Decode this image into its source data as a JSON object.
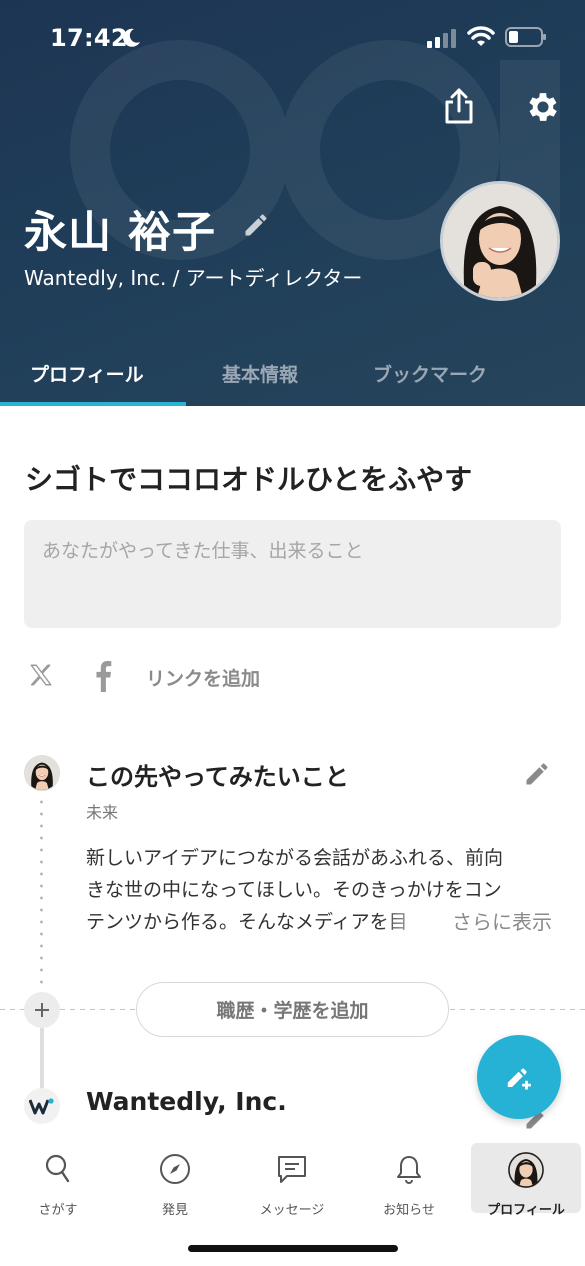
{
  "status_bar": {
    "time": "17:42"
  },
  "profile": {
    "name": "永山 裕子",
    "subtitle": "Wantedly, Inc. / アートディレクター"
  },
  "tabs": [
    {
      "label": "プロフィール",
      "active": true
    },
    {
      "label": "基本情報",
      "active": false
    },
    {
      "label": "ブックマーク",
      "active": false
    }
  ],
  "main": {
    "tagline": "シゴトでココロオドルひとをふやす",
    "about_placeholder": "あなたがやってきた仕事、出来ること",
    "add_link_label": "リンクを追加"
  },
  "future": {
    "title": "この先やってみたいこと",
    "label": "未来",
    "lines": [
      "新しいアイデアにつながる会話があふれる、前向",
      "きな世の中になってほしい。そのきっかけをコン",
      "テンツから作る。そんなメディアを目"
    ],
    "see_more": "さらに表示"
  },
  "career": {
    "add_button_label": "職歴・学歴を追加",
    "company_name": "Wantedly, Inc."
  },
  "bottom_nav": {
    "items": [
      {
        "label": "さがす",
        "icon": "search-icon"
      },
      {
        "label": "発見",
        "icon": "compass-icon"
      },
      {
        "label": "メッセージ",
        "icon": "message-icon"
      },
      {
        "label": "お知らせ",
        "icon": "bell-icon"
      },
      {
        "label": "プロフィール",
        "icon": "avatar",
        "active": true
      }
    ]
  },
  "colors": {
    "header_bg": "#1f3a56",
    "accent": "#26b2d4"
  }
}
